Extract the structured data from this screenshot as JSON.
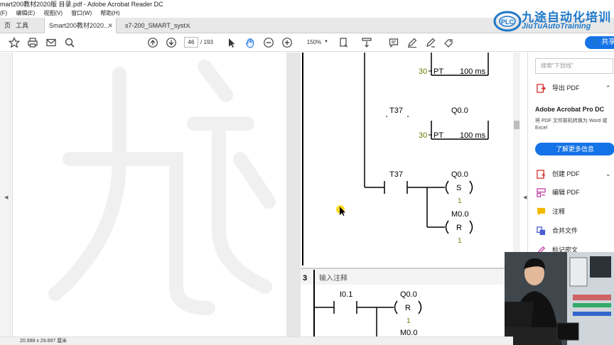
{
  "window": {
    "title": "mart200教材2020版 目录.pdf - Adobe Acrobat Reader DC"
  },
  "menu": [
    "(F)",
    "编辑(E)",
    "视图(V)",
    "窗口(W)",
    "帮助(H)"
  ],
  "tabs": [
    {
      "label": "页"
    },
    {
      "label": "工具"
    },
    {
      "label": "Smart200教材2020..."
    },
    {
      "label": "s7-200_SMART_syst..."
    }
  ],
  "toolbar": {
    "page_current": "46",
    "page_total": "/ 193",
    "zoom": "150%",
    "share_label": "共享"
  },
  "logo": {
    "cn": "九途自动化培训",
    "en": "JiuTuAutoTraining",
    "badge": "PLC"
  },
  "right_pane": {
    "search_placeholder": "搜索\"下划线\"",
    "items": [
      {
        "label": "导出 PDF",
        "icon": "export-pdf-icon",
        "color": "#d4322c"
      },
      {
        "label": "创建 PDF",
        "icon": "create-pdf-icon",
        "color": "#d4322c"
      },
      {
        "label": "编辑 PDF",
        "icon": "edit-pdf-icon",
        "color": "#c03fa8"
      },
      {
        "label": "注释",
        "icon": "comment-icon",
        "color": "#f2b800"
      },
      {
        "label": "合并文件",
        "icon": "combine-files-icon",
        "color": "#4b5bd1"
      },
      {
        "label": "标记密文",
        "icon": "redact-icon",
        "color": "#c03fa8"
      }
    ],
    "promo_title": "Adobe Acrobat Pro DC",
    "promo_desc": "将 PDF 文件联机转换为 Word 或 Excel",
    "learn_more": "了解更多信息"
  },
  "ladder": {
    "rung1": {
      "preset": "30",
      "pt": "PT",
      "time": "100 ms"
    },
    "rung1b": {
      "contact": "T37",
      "coil": "Q0.0",
      "preset": "30",
      "pt": "PT",
      "time": "100 ms"
    },
    "rung2": {
      "contact": "T37",
      "coil1": "Q0.0",
      "coil1_op": "S",
      "coil1_n": "1",
      "coil2": "M0.0",
      "coil2_op": "R",
      "coil2_n": "1"
    },
    "network3": {
      "number": "3",
      "comment": "输入注释",
      "contact": "I0.1",
      "coil1": "Q0.0",
      "coil1_op": "R",
      "coil1_n": "1",
      "coil2": "M0.0"
    }
  },
  "statusbar": {
    "dimensions": "20.998 x 29.697 厘米"
  }
}
